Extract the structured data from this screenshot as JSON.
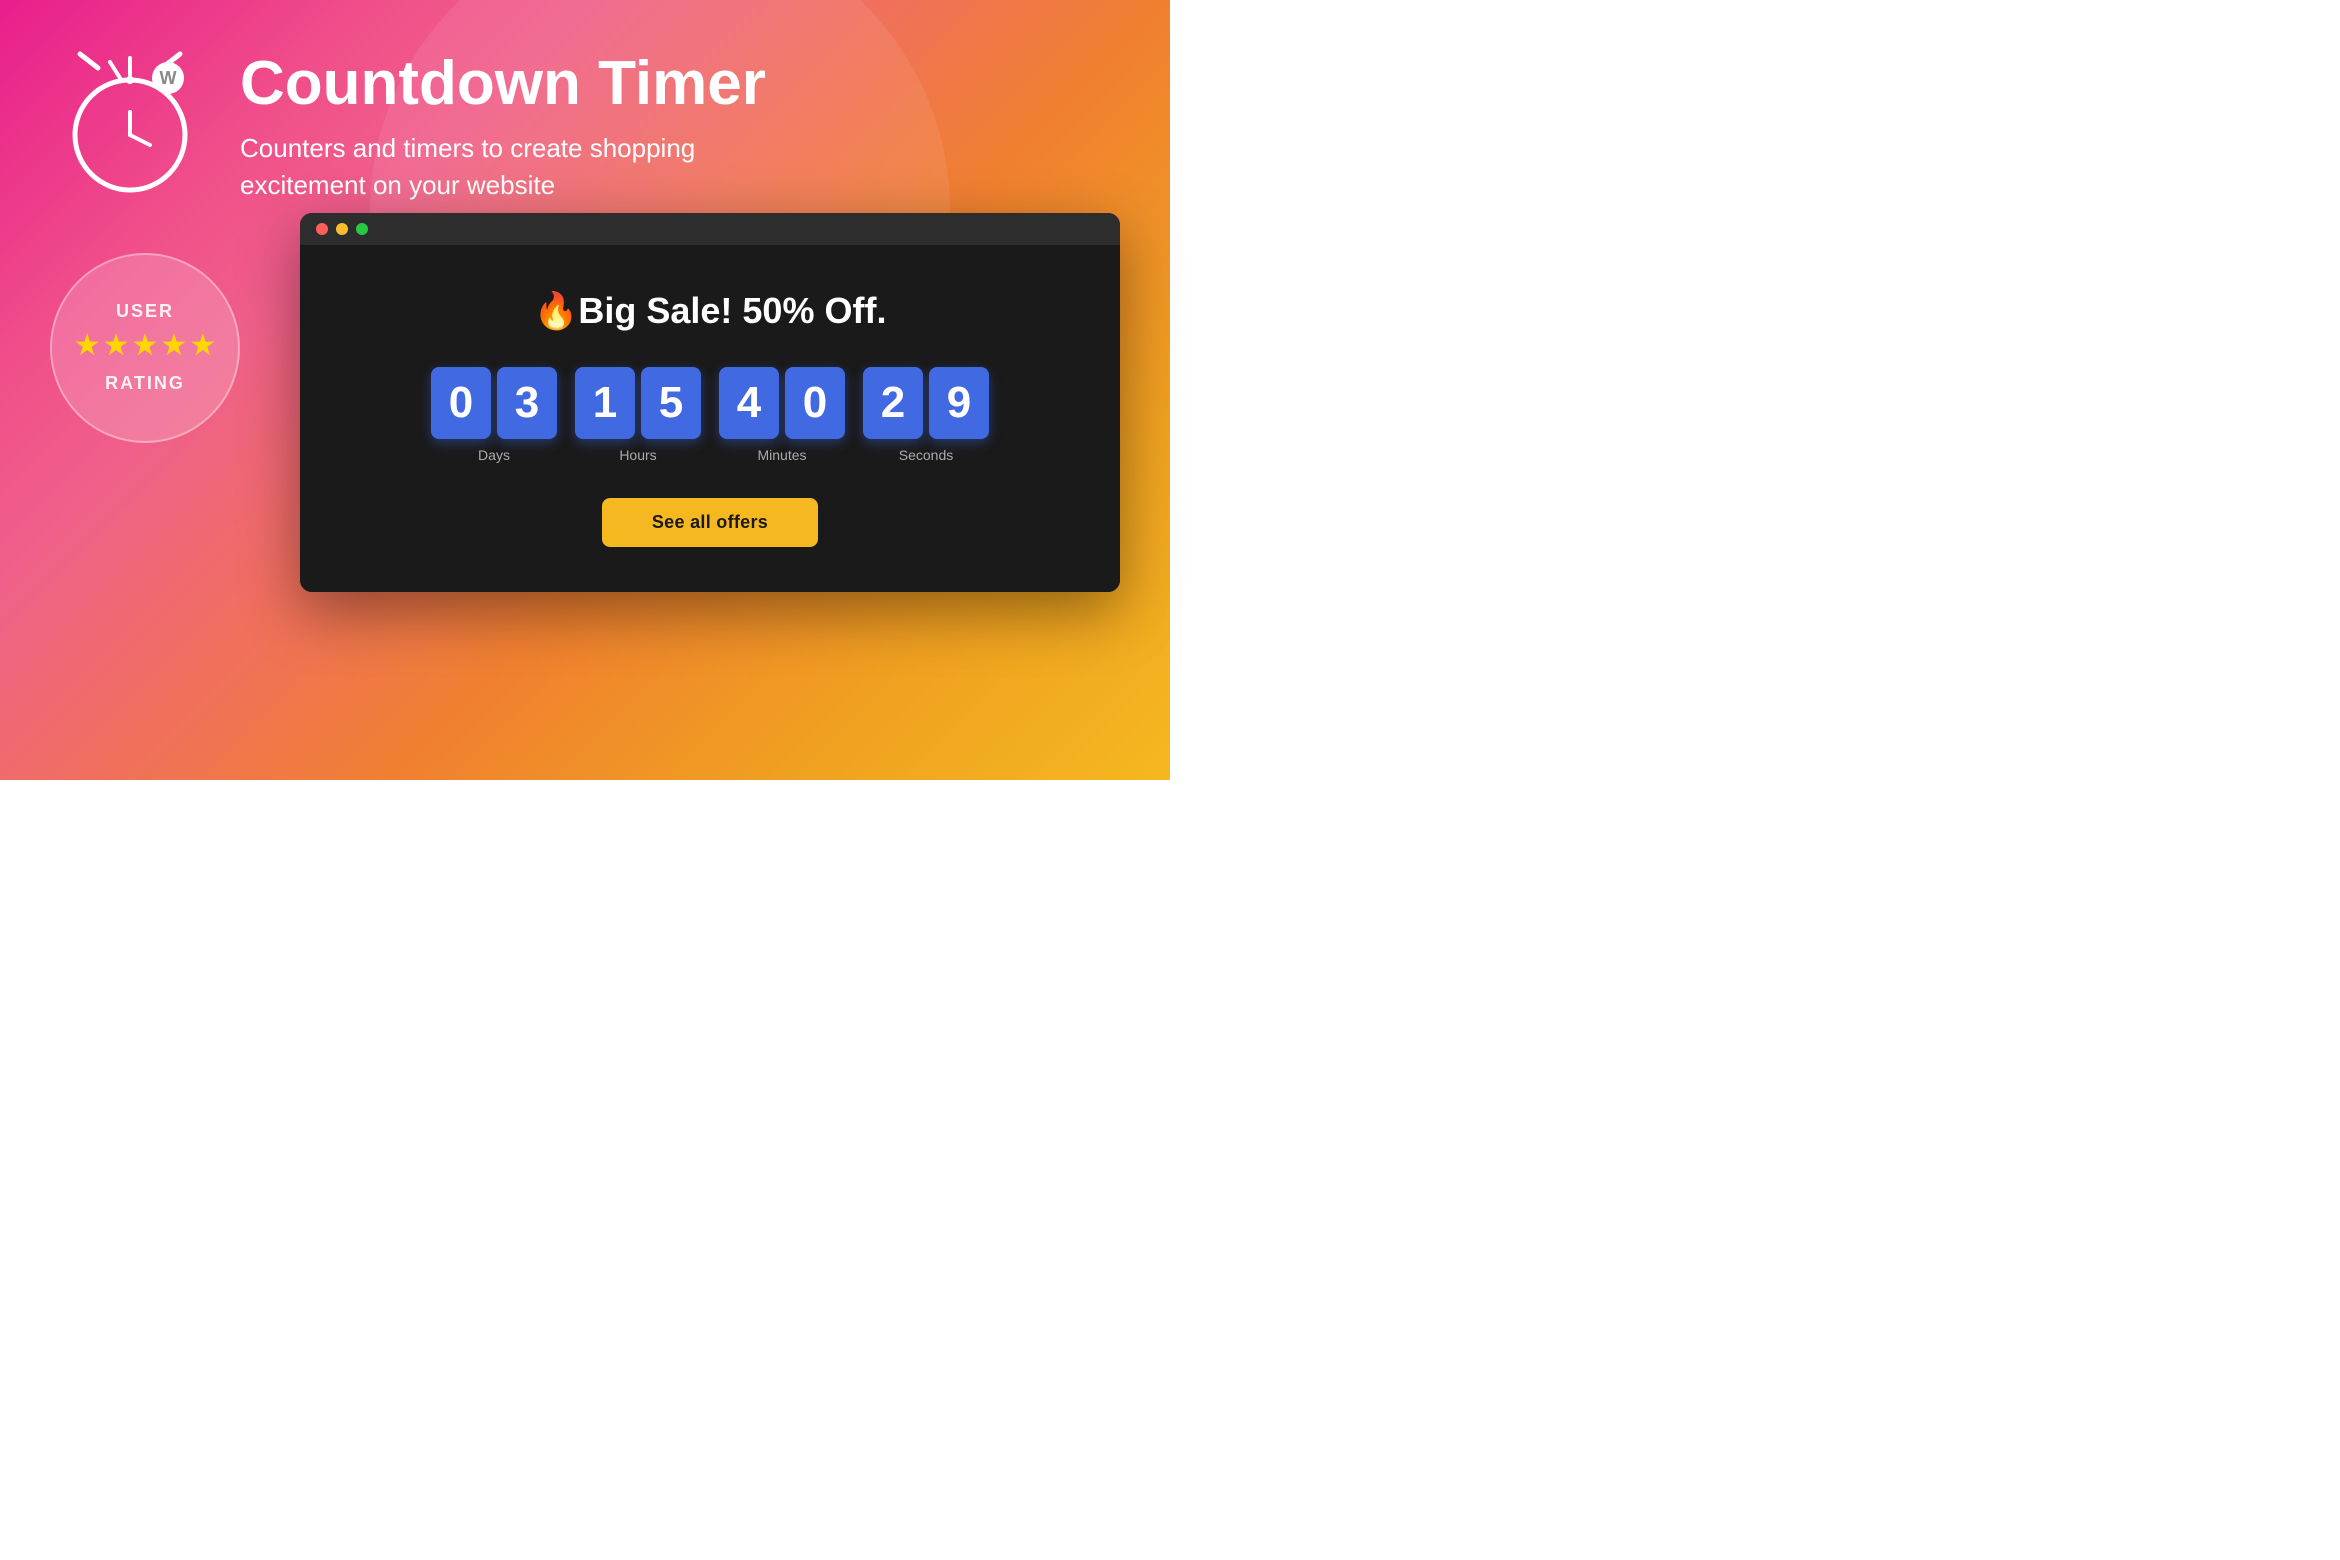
{
  "page": {
    "background_gradient": "linear-gradient(135deg, #e91e8c 0%, #f08030 60%, #f5b820 100%)"
  },
  "header": {
    "title": "Countdown Timer",
    "subtitle": "Counters and timers to create shopping excitement on your website"
  },
  "rating": {
    "user_label": "USER",
    "rating_label": "RATING",
    "stars": [
      "★",
      "★",
      "★",
      "★",
      "★"
    ],
    "star_color": "#FFD700"
  },
  "browser": {
    "dot1": "red",
    "dot2": "yellow",
    "dot3": "green"
  },
  "sale": {
    "heading": "🔥Big Sale! 50% Off.",
    "heading_icon": "🔥",
    "heading_text": "Big Sale! 50% Off."
  },
  "countdown": {
    "units": [
      {
        "digits": [
          "0",
          "3"
        ],
        "label": "Days"
      },
      {
        "digits": [
          "1",
          "5"
        ],
        "label": "Hours"
      },
      {
        "digits": [
          "4",
          "0"
        ],
        "label": "Minutes"
      },
      {
        "digits": [
          "2",
          "9"
        ],
        "label": "Seconds"
      }
    ]
  },
  "cta": {
    "label": "See all offers"
  }
}
